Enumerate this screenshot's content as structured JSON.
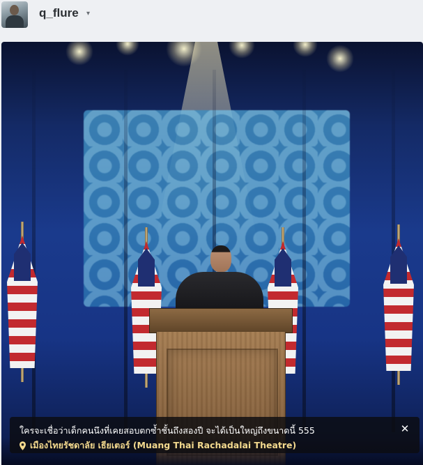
{
  "header": {
    "username": "q_flure",
    "avatar_icon": "user-avatar",
    "caret_icon": "caret-down-icon"
  },
  "post": {
    "caption": "ใครจะเชื่อว่าเด็กคนนึงที่เคยสอบตกซ้ำชั้นถึงสองปี จะได้เป็นใหญ่ถึงขนาดนี้ 555",
    "location": "เมืองไทยรัชดาลัย เธียเตอร์ (Muang Thai Rachadalai Theatre)",
    "location_icon": "map-pin-icon",
    "close_icon": "close-icon"
  },
  "colors": {
    "page_bg": "#eef0f3",
    "caption_bg": "rgba(12,12,16,0.82)",
    "location_text": "#f3d98e"
  }
}
